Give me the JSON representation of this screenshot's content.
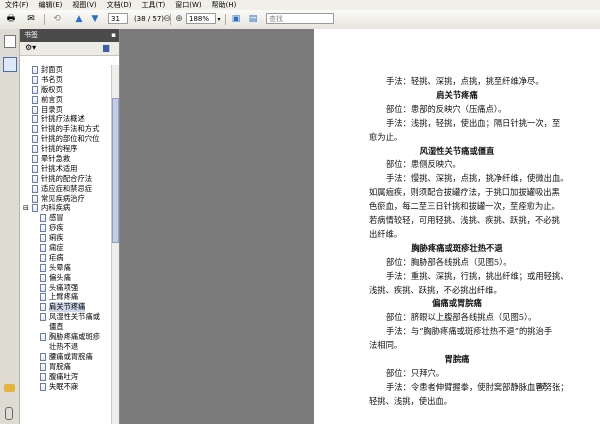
{
  "menu": [
    "文件(F)",
    "编辑(E)",
    "视图(V)",
    "文档(D)",
    "工具(T)",
    "窗口(W)",
    "帮助(H)"
  ],
  "toolbar": {
    "page_number": "31",
    "page_total": "(38 / 57)",
    "zoom": "188%",
    "search_placeholder": "查找"
  },
  "panel": {
    "title": "书签"
  },
  "bookmarks": [
    {
      "label": "封面页",
      "level": 1
    },
    {
      "label": "书名页",
      "level": 1
    },
    {
      "label": "版权页",
      "level": 1
    },
    {
      "label": "前言页",
      "level": 1
    },
    {
      "label": "目录页",
      "level": 1
    },
    {
      "label": "针挑疗法概述",
      "level": 1
    },
    {
      "label": "针挑的手法和方式",
      "level": 1
    },
    {
      "label": "针挑的部位和穴位",
      "level": 1
    },
    {
      "label": "针挑的程序",
      "level": 1
    },
    {
      "label": "晕针急救",
      "level": 1
    },
    {
      "label": "针挑术适用",
      "level": 1
    },
    {
      "label": "针挑的配合疗法",
      "level": 1
    },
    {
      "label": "适应症和禁忌症",
      "level": 1
    },
    {
      "label": "常见疾病治疗",
      "level": 1
    },
    {
      "label": "内科疾病",
      "level": 1,
      "expanded": true
    },
    {
      "label": "感冒",
      "level": 2
    },
    {
      "label": "痧疾",
      "level": 2
    },
    {
      "label": "痢疾",
      "level": 2
    },
    {
      "label": "痫症",
      "level": 2
    },
    {
      "label": "疟病",
      "level": 2
    },
    {
      "label": "头晕痛",
      "level": 2
    },
    {
      "label": "偏头痛",
      "level": 2
    },
    {
      "label": "头痛项强",
      "level": 2
    },
    {
      "label": "上臂疼痛",
      "level": 2
    },
    {
      "label": "肩关节疼痛",
      "level": 2,
      "selected": true
    },
    {
      "label": "风湿性关节痛或",
      "level": 2,
      "cont": "僵直"
    },
    {
      "label": "胸胁疼痛或斑疹",
      "level": 2,
      "cont": "壮热不退"
    },
    {
      "label": "腰痛或胃脘痛",
      "level": 2
    },
    {
      "label": "胃脘痛",
      "level": 2
    },
    {
      "label": "腹痛吐泻",
      "level": 2
    },
    {
      "label": "失眠不寐",
      "level": 2
    }
  ],
  "page": {
    "lines": [
      {
        "text": "手法：轻挑、深挑，点挑，挑至纤维净尽。",
        "type": "body"
      },
      {
        "text": "肩关节疼痛",
        "type": "heading"
      },
      {
        "text": "部位：患部的反映穴（压痛点）。",
        "type": "body"
      },
      {
        "text": "手法：浅挑，轻挑，使出血；隔日针挑一次，至",
        "type": "body"
      },
      {
        "text": "愈为止。",
        "type": "cont"
      },
      {
        "text": "风湿性关节痛或僵直",
        "type": "heading"
      },
      {
        "text": "部位：患侧反映穴。",
        "type": "body"
      },
      {
        "text": "手法：慢挑、深挑，点挑，挑净纤维，使微出血。",
        "type": "body"
      },
      {
        "text": "如属痼疾，则须配合拔罐疗法，于挑口加拔罐吸出黑",
        "type": "cont"
      },
      {
        "text": "色瘀血，每二至三日针挑和拔罐一次，至痊愈为止。",
        "type": "cont"
      },
      {
        "text": "若病情较轻，可用轻挑、浅挑、疾挑、跃挑，不必挑",
        "type": "cont"
      },
      {
        "text": "出纤维。",
        "type": "cont"
      },
      {
        "text": "胸胁疼痛或斑疹壮热不退",
        "type": "heading"
      },
      {
        "text": "部位：胸胁部各线挑点（见图5）。",
        "type": "body"
      },
      {
        "text": "手法：重挑、深挑，行挑，挑出纤维；或用轻挑、",
        "type": "body"
      },
      {
        "text": "浅挑、疾挑、跃挑，不必挑出纤维。",
        "type": "cont"
      },
      {
        "text": "偏痛或胃脘痛",
        "type": "heading"
      },
      {
        "text": "部位：脐眼以上腹部各线挑点（见图5）。",
        "type": "body"
      },
      {
        "text": "手法：与“胸胁疼痛或斑疹壮热不退”的挑治手",
        "type": "body"
      },
      {
        "text": "法相同。",
        "type": "cont"
      },
      {
        "text": "胃脘痛",
        "type": "heading"
      },
      {
        "text": "部位：只拜穴。",
        "type": "body"
      },
      {
        "text": "手法：令患者伸臂握拳，使肘窝部静脉血管努张；",
        "type": "body"
      },
      {
        "text": "轻挑、浅挑，使出血。",
        "type": "cont"
      }
    ],
    "page_number": "31"
  }
}
